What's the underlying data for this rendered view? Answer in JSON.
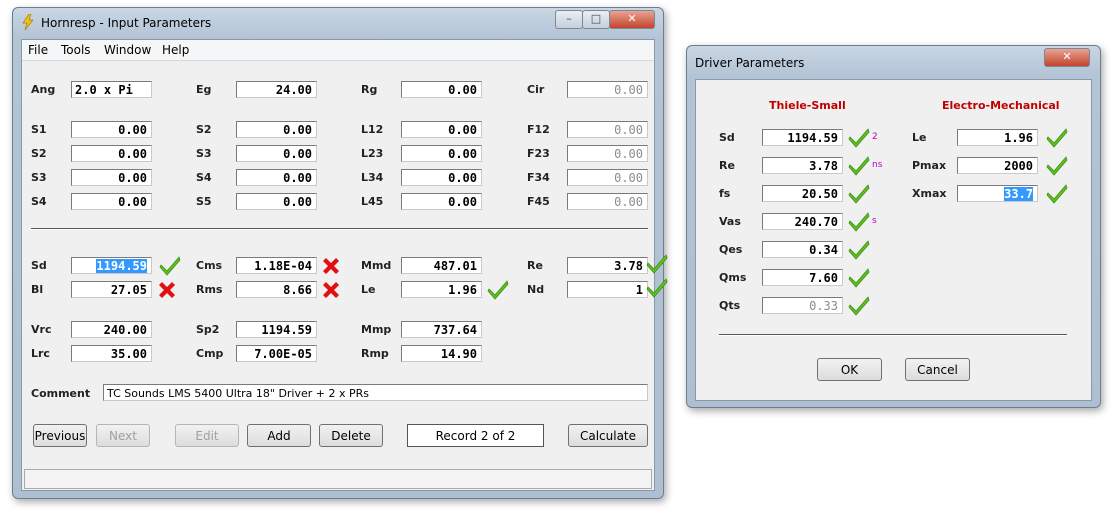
{
  "main": {
    "title": "Hornresp - Input Parameters",
    "menu": [
      "File",
      "Tools",
      "Window",
      "Help"
    ],
    "fields": {
      "ang": {
        "label": "Ang",
        "value": "2.0 x Pi"
      },
      "eg": {
        "label": "Eg",
        "value": "24.00"
      },
      "rg": {
        "label": "Rg",
        "value": "0.00"
      },
      "cir": {
        "label": "Cir",
        "value": "0.00"
      },
      "s1": {
        "label": "S1",
        "value": "0.00"
      },
      "s2": {
        "label": "S2",
        "value": "0.00"
      },
      "s3": {
        "label": "S3",
        "value": "0.00"
      },
      "s4": {
        "label": "S4",
        "value": "0.00"
      },
      "s2b": {
        "label": "S2",
        "value": "0.00"
      },
      "s3b": {
        "label": "S3",
        "value": "0.00"
      },
      "s4b": {
        "label": "S4",
        "value": "0.00"
      },
      "s5": {
        "label": "S5",
        "value": "0.00"
      },
      "l12": {
        "label": "L12",
        "value": "0.00"
      },
      "l23": {
        "label": "L23",
        "value": "0.00"
      },
      "l34": {
        "label": "L34",
        "value": "0.00"
      },
      "l45": {
        "label": "L45",
        "value": "0.00"
      },
      "f12": {
        "label": "F12",
        "value": "0.00"
      },
      "f23": {
        "label": "F23",
        "value": "0.00"
      },
      "f34": {
        "label": "F34",
        "value": "0.00"
      },
      "f45": {
        "label": "F45",
        "value": "0.00"
      },
      "sd": {
        "label": "Sd",
        "value": "1194.59"
      },
      "bl": {
        "label": "Bl",
        "value": "27.05"
      },
      "cms": {
        "label": "Cms",
        "value": "1.18E-04"
      },
      "rms": {
        "label": "Rms",
        "value": "8.66"
      },
      "mmd": {
        "label": "Mmd",
        "value": "487.01"
      },
      "le": {
        "label": "Le",
        "value": "1.96"
      },
      "re": {
        "label": "Re",
        "value": "3.78"
      },
      "nd": {
        "label": "Nd",
        "value": "1"
      },
      "vrc": {
        "label": "Vrc",
        "value": "240.00"
      },
      "lrc": {
        "label": "Lrc",
        "value": "35.00"
      },
      "sp2": {
        "label": "Sp2",
        "value": "1194.59"
      },
      "cmp": {
        "label": "Cmp",
        "value": "7.00E-05"
      },
      "mmp": {
        "label": "Mmp",
        "value": "737.64"
      },
      "rmp": {
        "label": "Rmp",
        "value": "14.90"
      }
    },
    "comment_label": "Comment",
    "comment": "TC Sounds LMS 5400 Ultra 18\" Driver + 2 x PRs",
    "buttons": {
      "previous": "Previous",
      "next": "Next",
      "edit": "Edit",
      "add": "Add",
      "delete": "Delete",
      "record": "Record 2 of 2",
      "calculate": "Calculate"
    }
  },
  "driver": {
    "title": "Driver Parameters",
    "ts_header": "Thiele-Small",
    "em_header": "Electro-Mechanical",
    "ts": {
      "sd": {
        "label": "Sd",
        "value": "1194.59",
        "unit": "2"
      },
      "re": {
        "label": "Re",
        "value": "3.78",
        "unit": "ns"
      },
      "fs": {
        "label": "fs",
        "value": "20.50"
      },
      "vas": {
        "label": "Vas",
        "value": "240.70",
        "unit": "s"
      },
      "qes": {
        "label": "Qes",
        "value": "0.34"
      },
      "qms": {
        "label": "Qms",
        "value": "7.60"
      },
      "qts": {
        "label": "Qts",
        "value": "0.33"
      }
    },
    "em": {
      "le": {
        "label": "Le",
        "value": "1.96"
      },
      "pmax": {
        "label": "Pmax",
        "value": "2000"
      },
      "xmax": {
        "label": "Xmax",
        "value": "33.7"
      }
    },
    "ok": "OK",
    "cancel": "Cancel"
  },
  "icons": {
    "check": "check-icon",
    "cross": "cross-icon",
    "app": "lightning-icon"
  },
  "colors": {
    "check": "#5cc21d",
    "cross": "#e01010",
    "header": "#c00000",
    "selection": "#3399ff"
  }
}
